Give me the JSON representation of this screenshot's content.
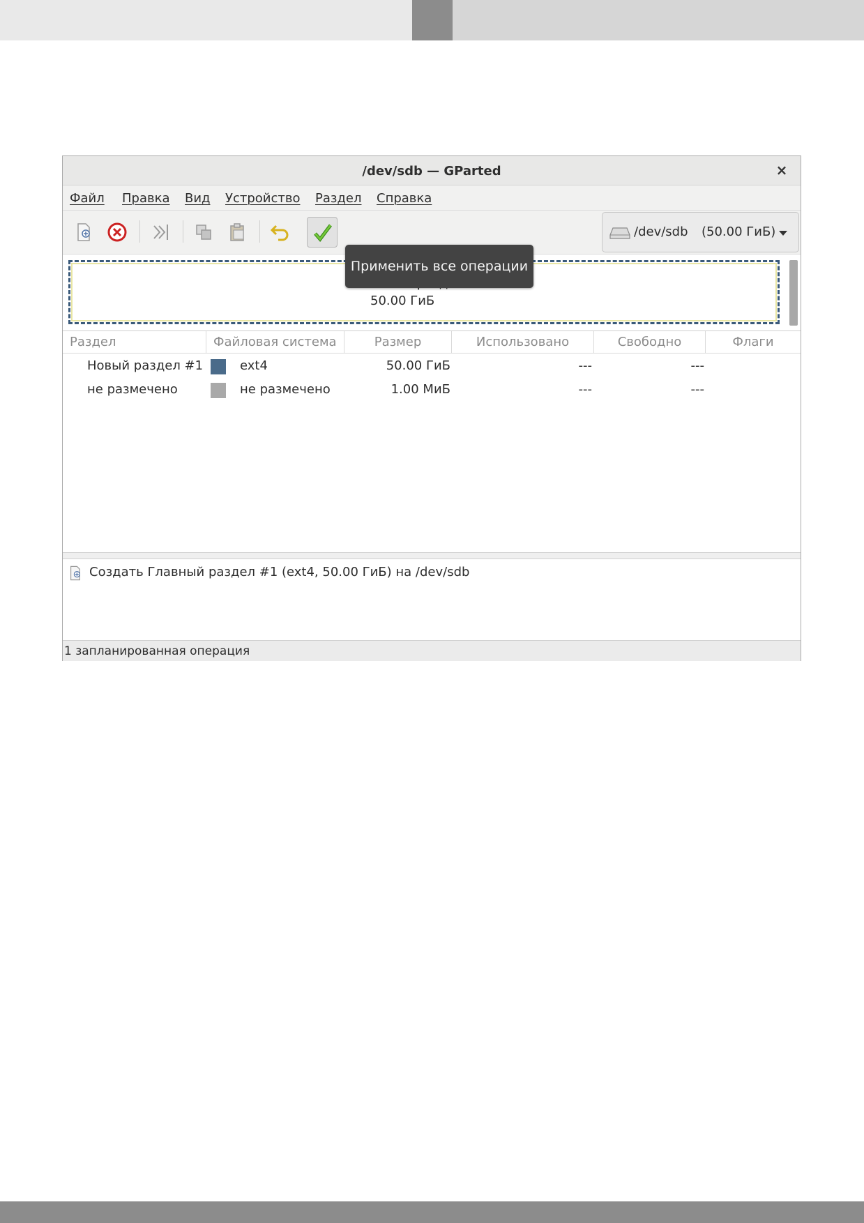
{
  "window": {
    "title": "/dev/sdb — GParted",
    "close_label": "×"
  },
  "menu": [
    "Файл",
    "Правка",
    "Вид",
    "Устройство",
    "Раздел",
    "Справка"
  ],
  "toolbar": {
    "buttons": [
      "new-partition",
      "delete-partition",
      "resize-move",
      "copy",
      "paste",
      "undo",
      "apply"
    ],
    "device": {
      "name": "/dev/sdb",
      "size": "(50.00 ГиБ)"
    }
  },
  "tooltip": "Применить все операции",
  "disk_map": {
    "partition_name": "Новый раздел #1",
    "partition_size": "50.00 ГиБ"
  },
  "table": {
    "columns": [
      "Раздел",
      "Файловая система",
      "Размер",
      "Использовано",
      "Свободно",
      "Флаги"
    ],
    "rows": [
      {
        "partition": "Новый раздел #1",
        "fs": "ext4",
        "fs_color": "#4a6b8a",
        "size": "50.00 ГиБ",
        "used": "---",
        "free": "---",
        "flags": ""
      },
      {
        "partition": "не размечено",
        "fs": "не размечено",
        "fs_color": "#a9a9a9",
        "size": "1.00 МиБ",
        "used": "---",
        "free": "---",
        "flags": ""
      }
    ]
  },
  "operations": [
    "Создать Главный раздел #1 (ext4, 50.00 ГиБ) на /dev/sdb"
  ],
  "status": "1 запланированная операция"
}
